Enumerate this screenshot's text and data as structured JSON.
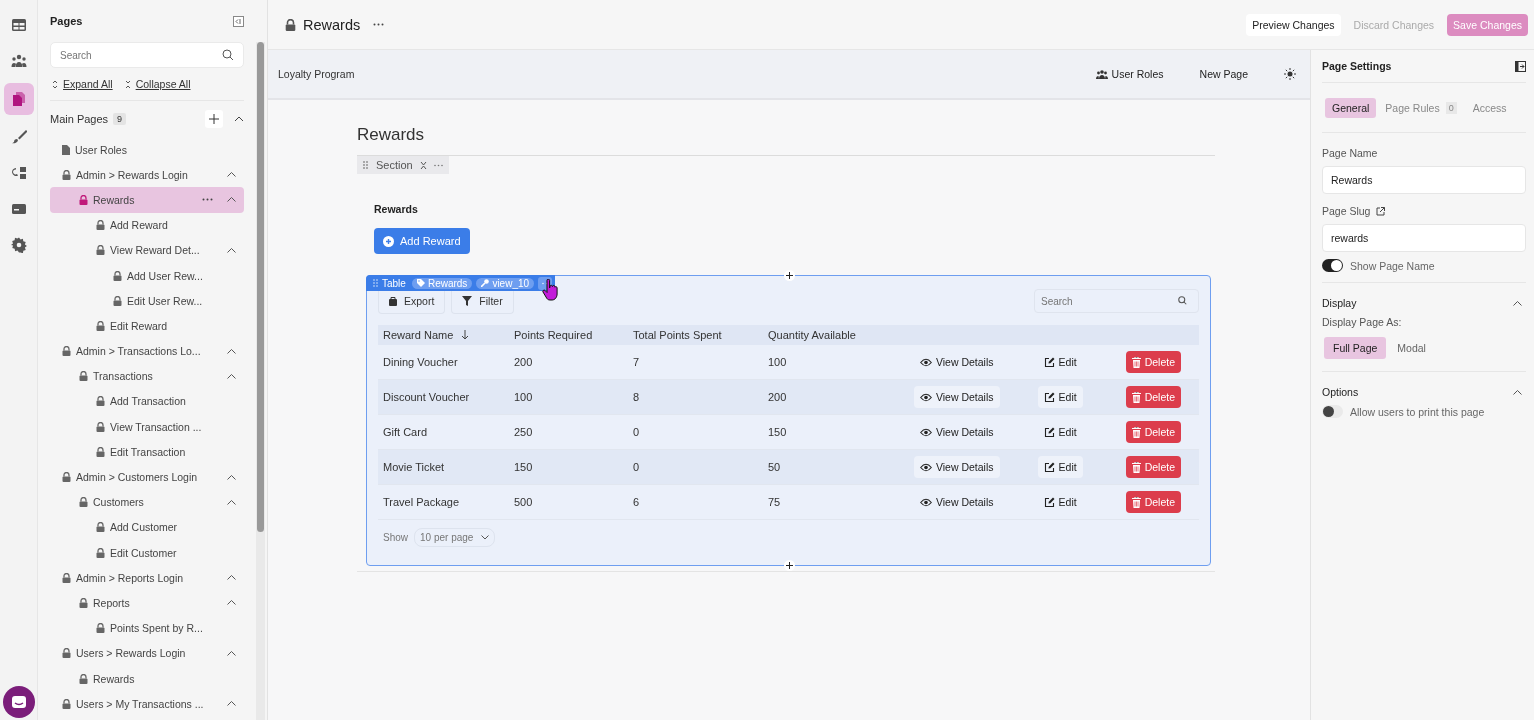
{
  "rail": [
    {
      "kind": "table",
      "selected": false
    },
    {
      "kind": "users",
      "selected": false
    },
    {
      "kind": "pages",
      "selected": true
    },
    {
      "kind": "brush",
      "selected": false
    },
    {
      "kind": "components",
      "selected": false
    },
    {
      "kind": "card",
      "selected": false
    },
    {
      "kind": "settings",
      "selected": false
    }
  ],
  "pages_panel": {
    "title": "Pages",
    "search": {
      "placeholder": "Search"
    },
    "expand_all": "Expand All",
    "collapse_all": "Collapse All",
    "group": {
      "label": "Main Pages",
      "count": "9",
      "expanded": true
    },
    "tree": [
      {
        "label": "User Roles",
        "kind": "file",
        "selected": false
      },
      {
        "label": "Admin > Rewards Login",
        "kind": "lock",
        "selected": false,
        "expanded": true,
        "children": [
          {
            "label": "Rewards",
            "kind": "lock",
            "selected": true,
            "expanded": true,
            "children": [
              {
                "label": "Add Reward",
                "kind": "lock",
                "selected": false
              },
              {
                "label": "View Reward Det...",
                "kind": "lock",
                "selected": false,
                "expanded": true,
                "children": [
                  {
                    "label": "Add User Rew...",
                    "kind": "lock",
                    "selected": false
                  },
                  {
                    "label": "Edit User Rew...",
                    "kind": "lock",
                    "selected": false
                  }
                ]
              },
              {
                "label": "Edit Reward",
                "kind": "lock",
                "selected": false
              }
            ]
          }
        ]
      },
      {
        "label": "Admin > Transactions Lo...",
        "kind": "lock",
        "selected": false,
        "expanded": true,
        "children": [
          {
            "label": "Transactions",
            "kind": "lock",
            "selected": false,
            "expanded": true,
            "children": [
              {
                "label": "Add Transaction",
                "kind": "lock",
                "selected": false
              },
              {
                "label": "View Transaction ...",
                "kind": "lock",
                "selected": false
              },
              {
                "label": "Edit Transaction",
                "kind": "lock",
                "selected": false
              }
            ]
          }
        ]
      },
      {
        "label": "Admin > Customers Login",
        "kind": "lock",
        "selected": false,
        "expanded": true,
        "children": [
          {
            "label": "Customers",
            "kind": "lock",
            "selected": false,
            "expanded": true,
            "children": [
              {
                "label": "Add Customer",
                "kind": "lock",
                "selected": false
              },
              {
                "label": "Edit Customer",
                "kind": "lock",
                "selected": false
              }
            ]
          }
        ]
      },
      {
        "label": "Admin > Reports Login",
        "kind": "lock",
        "selected": false,
        "expanded": true,
        "children": [
          {
            "label": "Reports",
            "kind": "lock",
            "selected": false,
            "expanded": true,
            "children": [
              {
                "label": "Points Spent by R...",
                "kind": "lock",
                "selected": false
              }
            ]
          }
        ]
      },
      {
        "label": "Users > Rewards Login",
        "kind": "lock",
        "selected": false,
        "expanded": true,
        "children": [
          {
            "label": "Rewards",
            "kind": "lock",
            "selected": false
          }
        ]
      },
      {
        "label": "Users > My Transactions ...",
        "kind": "lock",
        "selected": false,
        "expanded": true
      }
    ]
  },
  "top_bar": {
    "title": "Rewards",
    "buttons": [
      {
        "label": "Preview Changes",
        "kind": "preview"
      },
      {
        "label": "Discard Changes",
        "kind": "discard"
      },
      {
        "label": "Save Changes",
        "kind": "save"
      }
    ]
  },
  "app_header": {
    "title": "Loyalty Program",
    "links": [
      {
        "label": "User Roles",
        "kind": "roles"
      },
      {
        "label": "New Page",
        "kind": "plain"
      }
    ]
  },
  "page": {
    "title": "Rewards",
    "section_tag": "Section",
    "heading": "Rewards",
    "add_button": "Add Reward",
    "table": {
      "tags": [
        {
          "label": "Table",
          "kind": "plain"
        },
        {
          "label": "Rewards",
          "kind": "source"
        },
        {
          "label": "view_10",
          "kind": "view"
        }
      ],
      "toolbar": [
        {
          "label": "Export",
          "kind": "export"
        },
        {
          "label": "Filter",
          "kind": "filter"
        }
      ],
      "search": {
        "placeholder": "Search"
      },
      "columns": [
        {
          "label": "Reward Name",
          "sorted": true
        },
        {
          "label": "Points Required",
          "sorted": false
        },
        {
          "label": "Total Points Spent",
          "sorted": false
        },
        {
          "label": "Quantity Available",
          "sorted": false
        }
      ],
      "rows": [
        {
          "cells": [
            "Dining Voucher",
            "200",
            "7",
            "100"
          ],
          "actions": [
            {
              "label": "View Details",
              "kind": "view"
            },
            {
              "label": "Edit",
              "kind": "edit"
            },
            {
              "label": "Delete",
              "kind": "delete"
            }
          ]
        },
        {
          "cells": [
            "Discount Voucher",
            "100",
            "8",
            "200"
          ],
          "actions": [
            {
              "label": "View Details",
              "kind": "view"
            },
            {
              "label": "Edit",
              "kind": "edit"
            },
            {
              "label": "Delete",
              "kind": "delete"
            }
          ]
        },
        {
          "cells": [
            "Gift Card",
            "250",
            "0",
            "150"
          ],
          "actions": [
            {
              "label": "View Details",
              "kind": "view"
            },
            {
              "label": "Edit",
              "kind": "edit"
            },
            {
              "label": "Delete",
              "kind": "delete"
            }
          ]
        },
        {
          "cells": [
            "Movie Ticket",
            "150",
            "0",
            "50"
          ],
          "actions": [
            {
              "label": "View Details",
              "kind": "view"
            },
            {
              "label": "Edit",
              "kind": "edit"
            },
            {
              "label": "Delete",
              "kind": "delete"
            }
          ]
        },
        {
          "cells": [
            "Travel Package",
            "500",
            "6",
            "75"
          ],
          "actions": [
            {
              "label": "View Details",
              "kind": "view"
            },
            {
              "label": "Edit",
              "kind": "edit"
            },
            {
              "label": "Delete",
              "kind": "delete"
            }
          ]
        }
      ],
      "pagination": {
        "label": "Show",
        "value": "10 per page"
      }
    }
  },
  "settings": {
    "title": "Page Settings",
    "tabs": [
      {
        "label": "General",
        "selected": true
      },
      {
        "label": "Page Rules",
        "count": "0",
        "selected": false
      },
      {
        "label": "Access",
        "selected": false
      }
    ],
    "page_name": {
      "label": "Page Name",
      "value": "Rewards"
    },
    "page_slug": {
      "label": "Page Slug",
      "value": "rewards"
    },
    "show_page_name": {
      "label": "Show Page Name",
      "on": true
    },
    "display": {
      "title": "Display",
      "expanded": true,
      "label": "Display Page As:",
      "options": [
        {
          "label": "Full Page",
          "selected": true
        },
        {
          "label": "Modal",
          "selected": false
        }
      ]
    },
    "options": {
      "title": "Options",
      "expanded": true,
      "print": {
        "label": "Allow users to print this page",
        "on": false
      }
    }
  }
}
